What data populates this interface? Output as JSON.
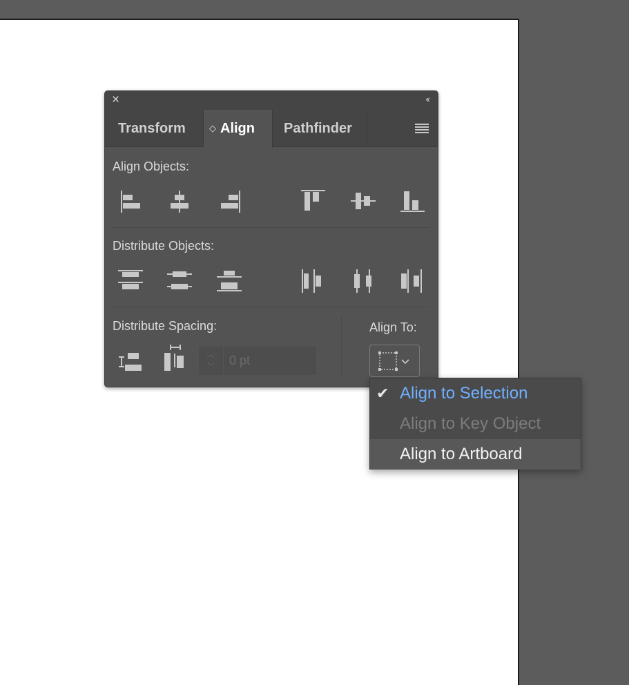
{
  "panel": {
    "tabs": [
      {
        "label": "Transform"
      },
      {
        "label": "Align",
        "active": true
      },
      {
        "label": "Pathfinder"
      }
    ],
    "align_objects_label": "Align Objects:",
    "distribute_objects_label": "Distribute Objects:",
    "distribute_spacing_label": "Distribute Spacing:",
    "spacing_value": "0 pt",
    "align_to_label": "Align To:"
  },
  "dropdown": {
    "items": [
      {
        "label": "Align to Selection",
        "checked": true
      },
      {
        "label": "Align to Key Object",
        "disabled": true
      },
      {
        "label": "Align to Artboard",
        "highlighted": true
      }
    ]
  },
  "icons": {
    "close": "close-icon",
    "collapse": "double-chevron-left-icon",
    "menu": "hamburger-menu-icon"
  },
  "colors": {
    "canvas": "#5c5c5c",
    "panel": "#535353",
    "tab_strip": "#454545",
    "accent_selected": "#6fb0ff"
  }
}
